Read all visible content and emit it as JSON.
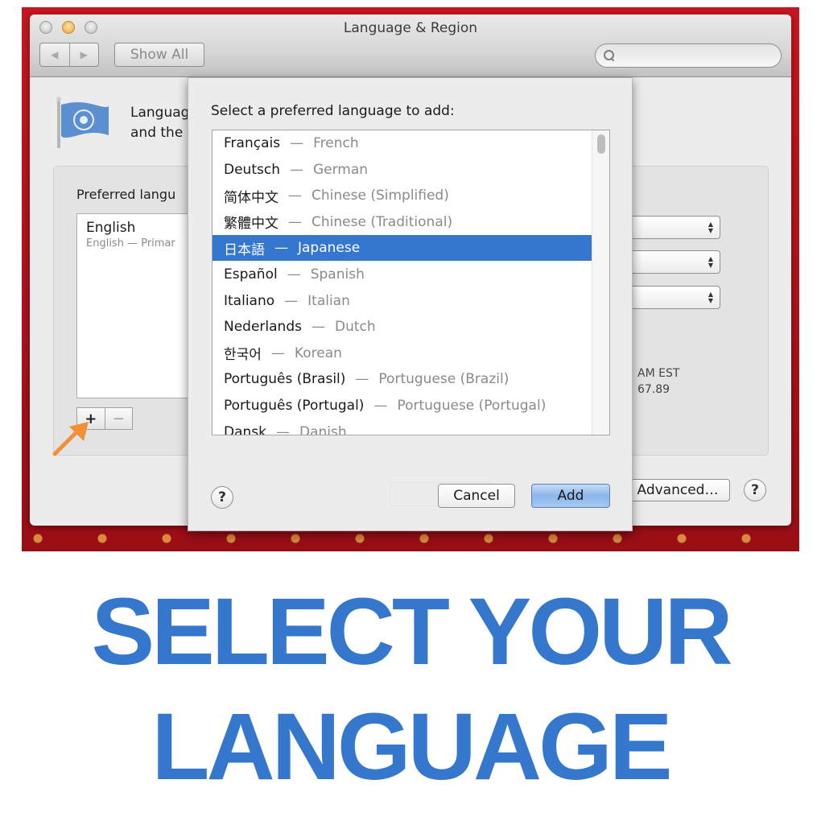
{
  "window": {
    "title": "Language & Region",
    "nav_back": "◀",
    "nav_forward": "▶",
    "show_all": "Show All",
    "search_placeholder": ""
  },
  "description": {
    "line1": "Language                                                                           s and dialogs,",
    "line2": "and the"
  },
  "preferred": {
    "label": "Preferred langu",
    "items": [
      {
        "name": "English",
        "subtitle": "English — Primar"
      }
    ],
    "add_label": "+",
    "remove_label": "−"
  },
  "right_panel": {
    "popups": [
      "",
      "",
      ""
    ],
    "status_time": "AM EST",
    "status_number": "67.89",
    "advanced_label": "Advanced…",
    "help_label": "?"
  },
  "sheet": {
    "title": "Select a preferred language to add:",
    "languages": [
      {
        "native": "Français",
        "english": "French"
      },
      {
        "native": "Deutsch",
        "english": "German"
      },
      {
        "native": "简体中文",
        "english": "Chinese (Simplified)"
      },
      {
        "native": "繁體中文",
        "english": "Chinese (Traditional)"
      },
      {
        "native": "日本語",
        "english": "Japanese"
      },
      {
        "native": "Español",
        "english": "Spanish"
      },
      {
        "native": "Italiano",
        "english": "Italian"
      },
      {
        "native": "Nederlands",
        "english": "Dutch"
      },
      {
        "native": "한국어",
        "english": "Korean"
      },
      {
        "native": "Português (Brasil)",
        "english": "Portuguese (Brazil)"
      },
      {
        "native": "Português (Portugal)",
        "english": "Portuguese (Portugal)"
      },
      {
        "native": "Dansk",
        "english": "Danish"
      }
    ],
    "selected_index": 4,
    "dash": "—",
    "help_label": "?",
    "cancel_label": "Cancel",
    "add_label": "Add"
  },
  "headline": {
    "line1": "SELECT YOUR",
    "line2": "LANGUAGE"
  },
  "colors": {
    "accent_blue": "#3677ce",
    "selection_blue": "#3576cf",
    "arrow_orange": "#f0913a",
    "wallpaper_red": "#b4141c"
  }
}
